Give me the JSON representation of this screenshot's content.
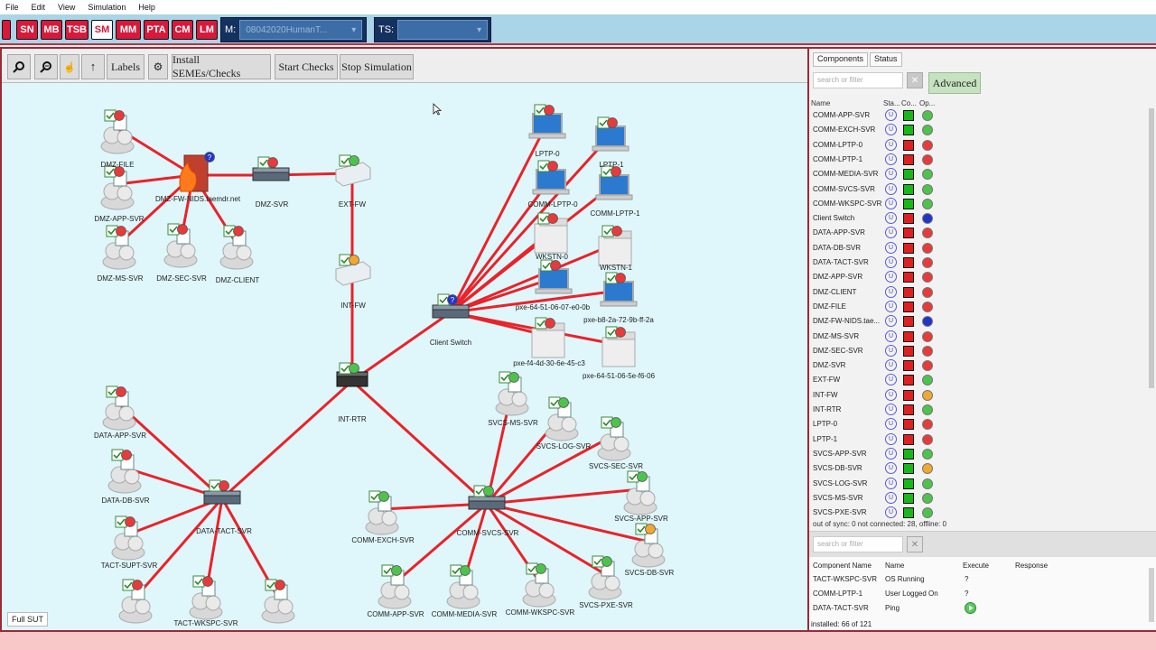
{
  "menu": [
    "File",
    "Edit",
    "View",
    "Simulation",
    "Help"
  ],
  "modes": [
    {
      "label": "SN",
      "active": false
    },
    {
      "label": "MB",
      "active": false
    },
    {
      "label": "TSB",
      "active": false
    },
    {
      "label": "SM",
      "active": true
    },
    {
      "label": "MM",
      "active": false
    },
    {
      "label": "PTA",
      "active": false
    },
    {
      "label": "CM",
      "active": false
    },
    {
      "label": "LM",
      "active": false
    }
  ],
  "selectors": {
    "m_label": "M:",
    "m_value": "08042020HumanT...",
    "ts_label": "TS:",
    "ts_value": ""
  },
  "toolbar": {
    "labels": "Labels",
    "install": "Install SEMEs/Checks",
    "start": "Start Checks",
    "stop": "Stop Simulation"
  },
  "graph": {
    "full_sut": "Full SUT",
    "nodes": [
      {
        "id": "DMZ-FILE",
        "label": "DMZ-FILE",
        "kind": "server",
        "status": "red"
      },
      {
        "id": "DMZ-APP-SVR",
        "label": "DMZ-APP-SVR",
        "kind": "server",
        "status": "red"
      },
      {
        "id": "DMZ-MS-SVR",
        "label": "DMZ-MS-SVR",
        "kind": "server",
        "status": "red"
      },
      {
        "id": "DMZ-SEC-SVR",
        "label": "DMZ-SEC-SVR",
        "kind": "server",
        "status": "red"
      },
      {
        "id": "DMZ-CLIENT",
        "label": "DMZ-CLIENT",
        "kind": "server",
        "status": "red"
      },
      {
        "id": "DMZ-FW-NIDS",
        "label": "DMZ-FW-NIDS.taemdr.net",
        "kind": "firewall",
        "status": "blue"
      },
      {
        "id": "DMZ-SVR",
        "label": "DMZ-SVR",
        "kind": "switch",
        "status": "red"
      },
      {
        "id": "EXT-FW",
        "label": "EXT-FW",
        "kind": "fw-box",
        "status": "green"
      },
      {
        "id": "INT-FW",
        "label": "INT-FW",
        "kind": "fw-box",
        "status": "orange"
      },
      {
        "id": "INT-RTR",
        "label": "INT-RTR",
        "kind": "router",
        "status": "green"
      },
      {
        "id": "Client Switch",
        "label": "Client Switch",
        "kind": "switch",
        "status": "blue"
      },
      {
        "id": "LPTP-0",
        "label": "LPTP-0",
        "kind": "laptop",
        "status": "red"
      },
      {
        "id": "LPTP-1",
        "label": "LPTP-1",
        "kind": "laptop",
        "status": "red"
      },
      {
        "id": "COMM-LPTP-0",
        "label": "COMM-LPTP-0",
        "kind": "laptop",
        "status": "red"
      },
      {
        "id": "COMM-LPTP-1",
        "label": "COMM-LPTP-1",
        "kind": "laptop",
        "status": "red"
      },
      {
        "id": "WKSTN-0",
        "label": "WKSTN-0",
        "kind": "tower",
        "status": "red"
      },
      {
        "id": "WKSTN-1",
        "label": "WKSTN-1",
        "kind": "tower",
        "status": "red"
      },
      {
        "id": "pxe-64-51-06-07-e0-0b",
        "label": "pxe-64-51-06-07-e0-0b",
        "kind": "laptop",
        "status": "red"
      },
      {
        "id": "pxe-b8-2a-72-9b-ff-2a",
        "label": "pxe-b8-2a-72-9b-ff-2a",
        "kind": "laptop",
        "status": "red"
      },
      {
        "id": "pxe-f4-4d-30-6e-45-c3",
        "label": "pxe-f4-4d-30-6e-45-c3",
        "kind": "tower",
        "status": "red"
      },
      {
        "id": "pxe-64-51-06-5e-f6-06",
        "label": "pxe-64-51-06-5e-f6-06",
        "kind": "tower",
        "status": "red"
      },
      {
        "id": "DATA-APP-SVR",
        "label": "DATA-APP-SVR",
        "kind": "server",
        "status": "red"
      },
      {
        "id": "DATA-DB-SVR",
        "label": "DATA-DB-SVR",
        "kind": "server",
        "status": "red"
      },
      {
        "id": "TACT-SUPT-SVR",
        "label": "TACT-SUPT-SVR",
        "kind": "server",
        "status": "red"
      },
      {
        "id": "DATA-TACT-SVR",
        "label": "DATA-TACT-SVR",
        "kind": "switch",
        "status": "red"
      },
      {
        "id": "DATA-x1",
        "label": "",
        "kind": "server",
        "status": "red"
      },
      {
        "id": "TACT-WKSPC-SVR",
        "label": "TACT-WKSPC-SVR",
        "kind": "server",
        "status": "red"
      },
      {
        "id": "DATA-x2",
        "label": "",
        "kind": "server",
        "status": "red"
      },
      {
        "id": "SVCS-MS-SVR",
        "label": "SVCS-MS-SVR",
        "kind": "server",
        "status": "green"
      },
      {
        "id": "SVCS-LOG-SVR",
        "label": "SVCS-LOG-SVR",
        "kind": "server",
        "status": "green"
      },
      {
        "id": "SVCS-SEC-SVR",
        "label": "SVCS-SEC-SVR",
        "kind": "server",
        "status": "green"
      },
      {
        "id": "SVCS-APP-SVR",
        "label": "SVCS-APP-SVR",
        "kind": "server",
        "status": "green"
      },
      {
        "id": "SVCS-DB-SVR",
        "label": "SVCS-DB-SVR",
        "kind": "server",
        "status": "orange"
      },
      {
        "id": "SVCS-PXE-SVR",
        "label": "SVCS-PXE-SVR",
        "kind": "server",
        "status": "green"
      },
      {
        "id": "COMM-WKSPC-SVR",
        "label": "COMM-WKSPC-SVR",
        "kind": "server",
        "status": "green"
      },
      {
        "id": "COMM-MEDIA-SVR",
        "label": "COMM-MEDIA-SVR",
        "kind": "server",
        "status": "green"
      },
      {
        "id": "COMM-APP-SVR",
        "label": "COMM-APP-SVR",
        "kind": "server",
        "status": "green"
      },
      {
        "id": "COMM-EXCH-SVR",
        "label": "COMM-EXCH-SVR",
        "kind": "server",
        "status": "green"
      },
      {
        "id": "COMM-SVCS-SVR",
        "label": "COMM-SVCS-SVR",
        "kind": "switch",
        "status": "green"
      }
    ],
    "edges": [
      [
        "DMZ-FILE",
        "DMZ-FW-NIDS"
      ],
      [
        "DMZ-APP-SVR",
        "DMZ-FW-NIDS"
      ],
      [
        "DMZ-MS-SVR",
        "DMZ-FW-NIDS"
      ],
      [
        "DMZ-SEC-SVR",
        "DMZ-FW-NIDS"
      ],
      [
        "DMZ-CLIENT",
        "DMZ-FW-NIDS"
      ],
      [
        "DMZ-FW-NIDS",
        "DMZ-SVR"
      ],
      [
        "DMZ-SVR",
        "EXT-FW"
      ],
      [
        "EXT-FW",
        "INT-FW"
      ],
      [
        "INT-FW",
        "INT-RTR"
      ],
      [
        "INT-RTR",
        "Client Switch"
      ],
      [
        "INT-RTR",
        "DATA-TACT-SVR"
      ],
      [
        "INT-RTR",
        "COMM-SVCS-SVR"
      ],
      [
        "Client Switch",
        "LPTP-0"
      ],
      [
        "Client Switch",
        "LPTP-1"
      ],
      [
        "Client Switch",
        "COMM-LPTP-0"
      ],
      [
        "Client Switch",
        "COMM-LPTP-1"
      ],
      [
        "Client Switch",
        "WKSTN-0"
      ],
      [
        "Client Switch",
        "WKSTN-1"
      ],
      [
        "Client Switch",
        "pxe-64-51-06-07-e0-0b"
      ],
      [
        "Client Switch",
        "pxe-b8-2a-72-9b-ff-2a"
      ],
      [
        "Client Switch",
        "pxe-f4-4d-30-6e-45-c3"
      ],
      [
        "Client Switch",
        "pxe-64-51-06-5e-f6-06"
      ],
      [
        "DATA-TACT-SVR",
        "DATA-APP-SVR"
      ],
      [
        "DATA-TACT-SVR",
        "DATA-DB-SVR"
      ],
      [
        "DATA-TACT-SVR",
        "TACT-SUPT-SVR"
      ],
      [
        "DATA-TACT-SVR",
        "DATA-x1"
      ],
      [
        "DATA-TACT-SVR",
        "TACT-WKSPC-SVR"
      ],
      [
        "DATA-TACT-SVR",
        "DATA-x2"
      ],
      [
        "COMM-SVCS-SVR",
        "SVCS-MS-SVR"
      ],
      [
        "COMM-SVCS-SVR",
        "SVCS-LOG-SVR"
      ],
      [
        "COMM-SVCS-SVR",
        "SVCS-SEC-SVR"
      ],
      [
        "COMM-SVCS-SVR",
        "SVCS-APP-SVR"
      ],
      [
        "COMM-SVCS-SVR",
        "SVCS-DB-SVR"
      ],
      [
        "COMM-SVCS-SVR",
        "SVCS-PXE-SVR"
      ],
      [
        "COMM-SVCS-SVR",
        "COMM-WKSPC-SVR"
      ],
      [
        "COMM-SVCS-SVR",
        "COMM-MEDIA-SVR"
      ],
      [
        "COMM-SVCS-SVR",
        "COMM-APP-SVR"
      ],
      [
        "COMM-SVCS-SVR",
        "COMM-EXCH-SVR"
      ]
    ]
  },
  "components": {
    "tabs": [
      "Components",
      "Status"
    ],
    "search_placeholder": "search or filter",
    "advanced": "Advanced",
    "col_name": "Name",
    "col_status": "Sta...",
    "col_conn": "Co...",
    "col_op": "Op...",
    "rows": [
      {
        "name": "COMM-APP-SVR",
        "conn": "green",
        "op": "green"
      },
      {
        "name": "COMM-EXCH-SVR",
        "conn": "green",
        "op": "green"
      },
      {
        "name": "COMM-LPTP-0",
        "conn": "red",
        "op": "red"
      },
      {
        "name": "COMM-LPTP-1",
        "conn": "red",
        "op": "red"
      },
      {
        "name": "COMM-MEDIA-SVR",
        "conn": "green",
        "op": "green"
      },
      {
        "name": "COMM-SVCS-SVR",
        "conn": "green",
        "op": "green"
      },
      {
        "name": "COMM-WKSPC-SVR",
        "conn": "green",
        "op": "green"
      },
      {
        "name": "Client Switch",
        "conn": "red",
        "op": "blue"
      },
      {
        "name": "DATA-APP-SVR",
        "conn": "red",
        "op": "red"
      },
      {
        "name": "DATA-DB-SVR",
        "conn": "red",
        "op": "red"
      },
      {
        "name": "DATA-TACT-SVR",
        "conn": "red",
        "op": "red"
      },
      {
        "name": "DMZ-APP-SVR",
        "conn": "red",
        "op": "red"
      },
      {
        "name": "DMZ-CLIENT",
        "conn": "red",
        "op": "red"
      },
      {
        "name": "DMZ-FILE",
        "conn": "red",
        "op": "red"
      },
      {
        "name": "DMZ-FW-NIDS.tae...",
        "conn": "red",
        "op": "blue"
      },
      {
        "name": "DMZ-MS-SVR",
        "conn": "red",
        "op": "red"
      },
      {
        "name": "DMZ-SEC-SVR",
        "conn": "red",
        "op": "red"
      },
      {
        "name": "DMZ-SVR",
        "conn": "red",
        "op": "red"
      },
      {
        "name": "EXT-FW",
        "conn": "red",
        "op": "green"
      },
      {
        "name": "INT-FW",
        "conn": "red",
        "op": "orange"
      },
      {
        "name": "INT-RTR",
        "conn": "red",
        "op": "green"
      },
      {
        "name": "LPTP-0",
        "conn": "red",
        "op": "red"
      },
      {
        "name": "LPTP-1",
        "conn": "red",
        "op": "red"
      },
      {
        "name": "SVCS-APP-SVR",
        "conn": "green",
        "op": "green"
      },
      {
        "name": "SVCS-DB-SVR",
        "conn": "green",
        "op": "orange"
      },
      {
        "name": "SVCS-LOG-SVR",
        "conn": "green",
        "op": "green"
      },
      {
        "name": "SVCS-MS-SVR",
        "conn": "green",
        "op": "green"
      },
      {
        "name": "SVCS-PXE-SVR",
        "conn": "green",
        "op": "green"
      }
    ],
    "status_letter": "U",
    "summary": "out of sync: 0 not connected: 28, offline: 0"
  },
  "checks": {
    "search_placeholder": "search or filter",
    "col_component": "Component Name",
    "col_name": "Name",
    "col_execute": "Execute",
    "col_response": "Response",
    "rows": [
      {
        "component": "TACT-WKSPC-SVR",
        "name": "OS Running",
        "execute": "?"
      },
      {
        "component": "COMM-LPTP-1",
        "name": "User Logged On",
        "execute": "?"
      },
      {
        "component": "DATA-TACT-SVR",
        "name": "Ping",
        "execute": ""
      }
    ],
    "installed": "installed: 66 of 121"
  },
  "colors": {
    "green": "#4cc44c",
    "red": "#e83a3a",
    "blue": "#2233cc",
    "orange": "#f0a830",
    "link": "#e8232a",
    "mode_red": "#d8193b"
  }
}
